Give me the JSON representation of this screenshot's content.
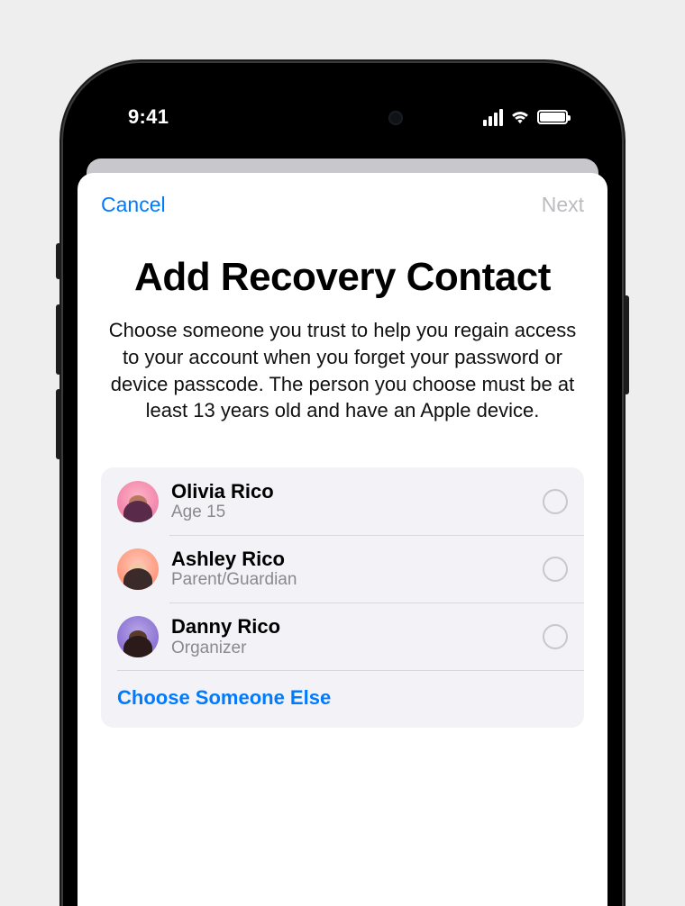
{
  "status": {
    "time": "9:41"
  },
  "nav": {
    "cancel": "Cancel",
    "next": "Next"
  },
  "page": {
    "title": "Add Recovery Contact",
    "description": "Choose someone you trust to help you regain access to your account when you forget your password or device passcode. The person you choose must be at least 13 years old and have an Apple device."
  },
  "contacts": [
    {
      "name": "Olivia Rico",
      "subtitle": "Age 15"
    },
    {
      "name": "Ashley Rico",
      "subtitle": "Parent/Guardian"
    },
    {
      "name": "Danny Rico",
      "subtitle": "Organizer"
    }
  ],
  "choose_else": "Choose Someone Else"
}
